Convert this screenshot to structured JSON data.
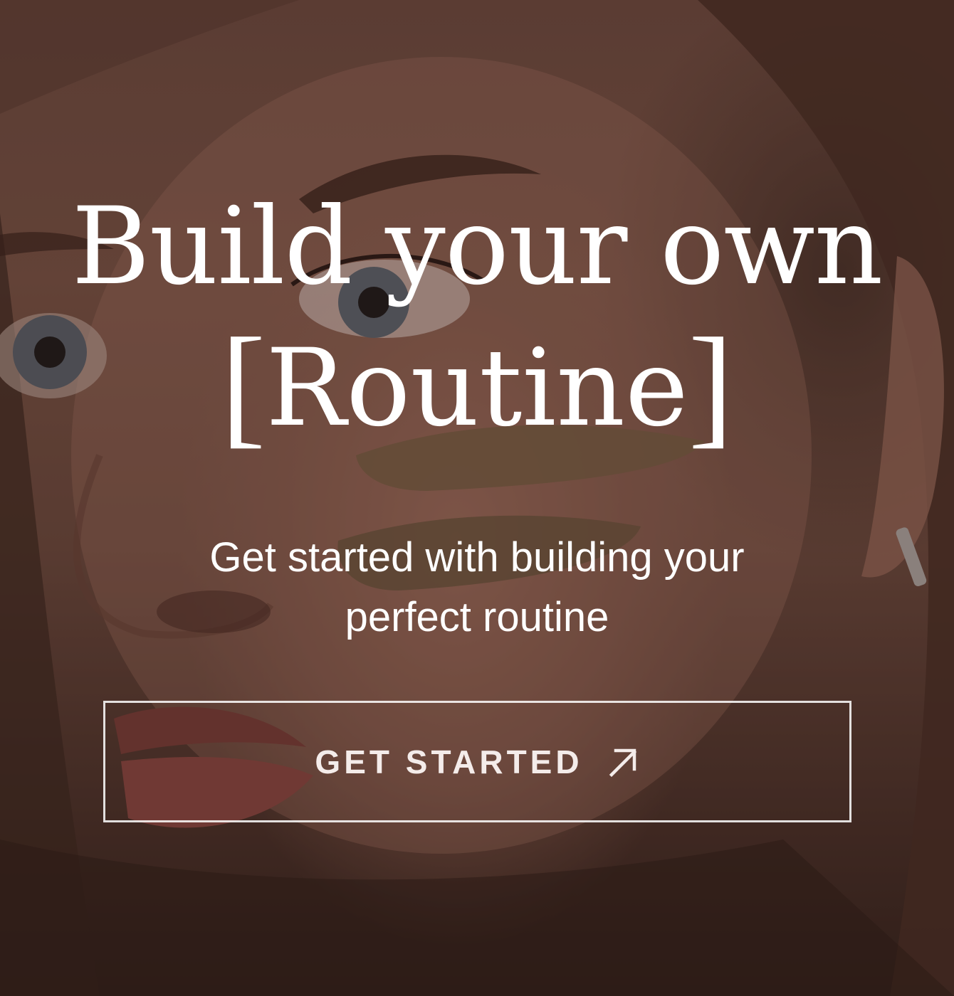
{
  "hero": {
    "title_line1": "Build your own",
    "title_line2": "Routine",
    "bracket_open": "[",
    "bracket_close": "]",
    "subtitle": "Get started with building your perfect routine",
    "image_subject": "close-up of a woman's face with an exfoliating scrub applied to her cheek"
  },
  "cta": {
    "label": "GET STARTED",
    "icon": "arrow-up-right-icon"
  },
  "colors": {
    "text": "#ffffff",
    "button_border": "#ffffff",
    "overlay": "#281612"
  }
}
